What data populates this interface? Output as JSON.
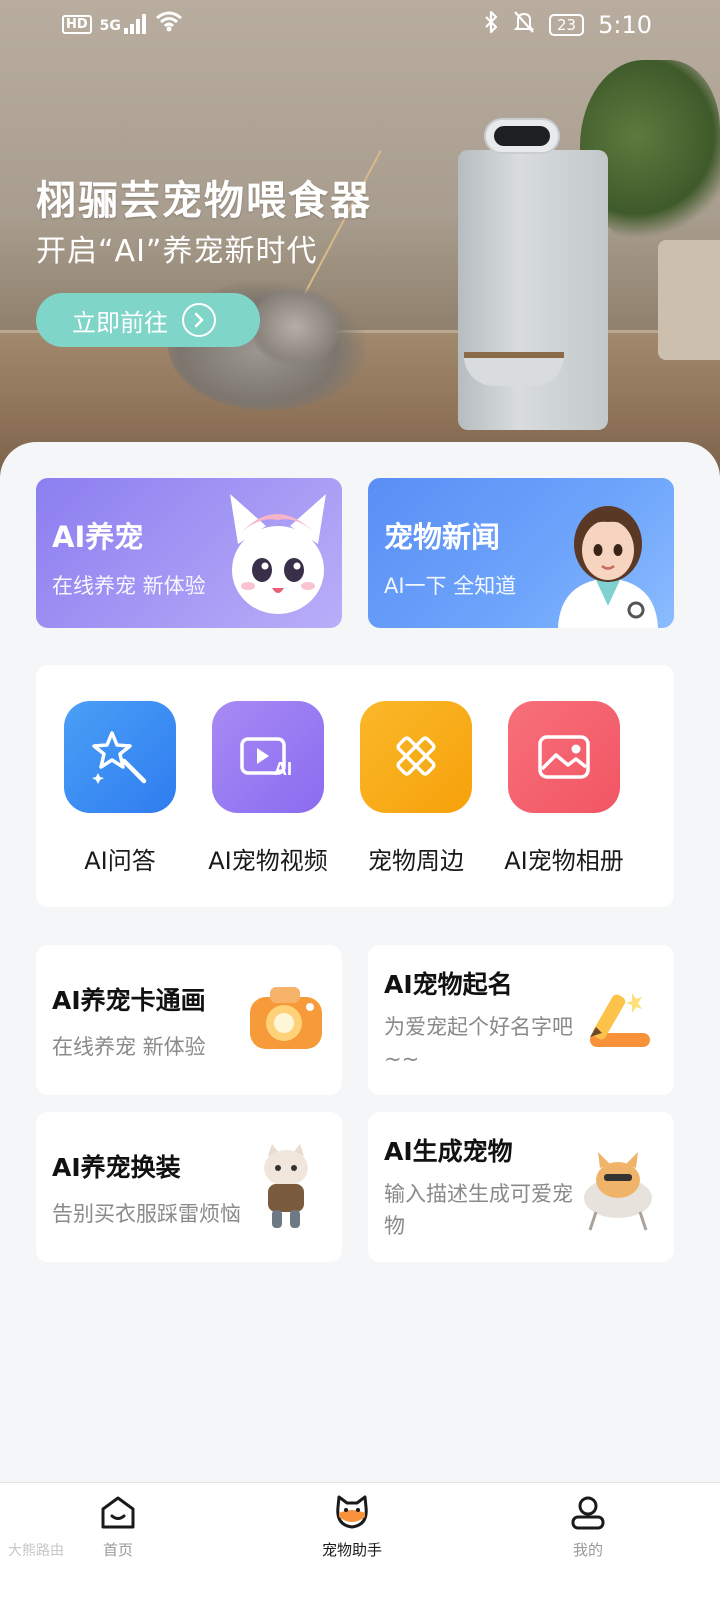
{
  "status_bar": {
    "network_badge": "HD",
    "signal_label": "5G",
    "battery": "23",
    "time": "5:10"
  },
  "hero": {
    "title": "栩骊芸宠物喂食器",
    "subtitle": "开启“AI”养宠新时代",
    "cta_label": "立即前往"
  },
  "promos": [
    {
      "title": "AI养宠",
      "subtitle": "在线养宠 新体验",
      "color": "#8b7ef0"
    },
    {
      "title": "宠物新闻",
      "subtitle": "AI一下 全知道",
      "color": "#5a8ef5"
    }
  ],
  "tools": [
    {
      "label": "AI问答",
      "icon": "magic-wand-icon",
      "color": "#3d8ef2"
    },
    {
      "label": "AI宠物视频",
      "icon": "video-ai-icon",
      "color": "#9b78f2"
    },
    {
      "label": "宠物周边",
      "icon": "ruler-pencil-icon",
      "color": "#f8ab12"
    },
    {
      "label": "AI宠物相册",
      "icon": "photo-album-icon",
      "color": "#f5626e"
    }
  ],
  "features": [
    {
      "title": "AI养宠卡通画",
      "subtitle": "在线养宠 新体验",
      "icon": "camera-icon"
    },
    {
      "title": "AI宠物起名",
      "subtitle": "为爱宠起个好名字吧~~",
      "icon": "pen-icon"
    },
    {
      "title": "AI养宠换装",
      "subtitle": "告别买衣服踩雷烦恼",
      "icon": "dressed-cat-icon"
    },
    {
      "title": "AI生成宠物",
      "subtitle": "输入描述生成可爱宠物",
      "icon": "cat-chair-icon"
    }
  ],
  "bottom_nav": {
    "home_label": "首页",
    "assistant_label": "宠物助手",
    "mine_label": "我的",
    "active": "assistant"
  },
  "watermark": "大熊路由"
}
